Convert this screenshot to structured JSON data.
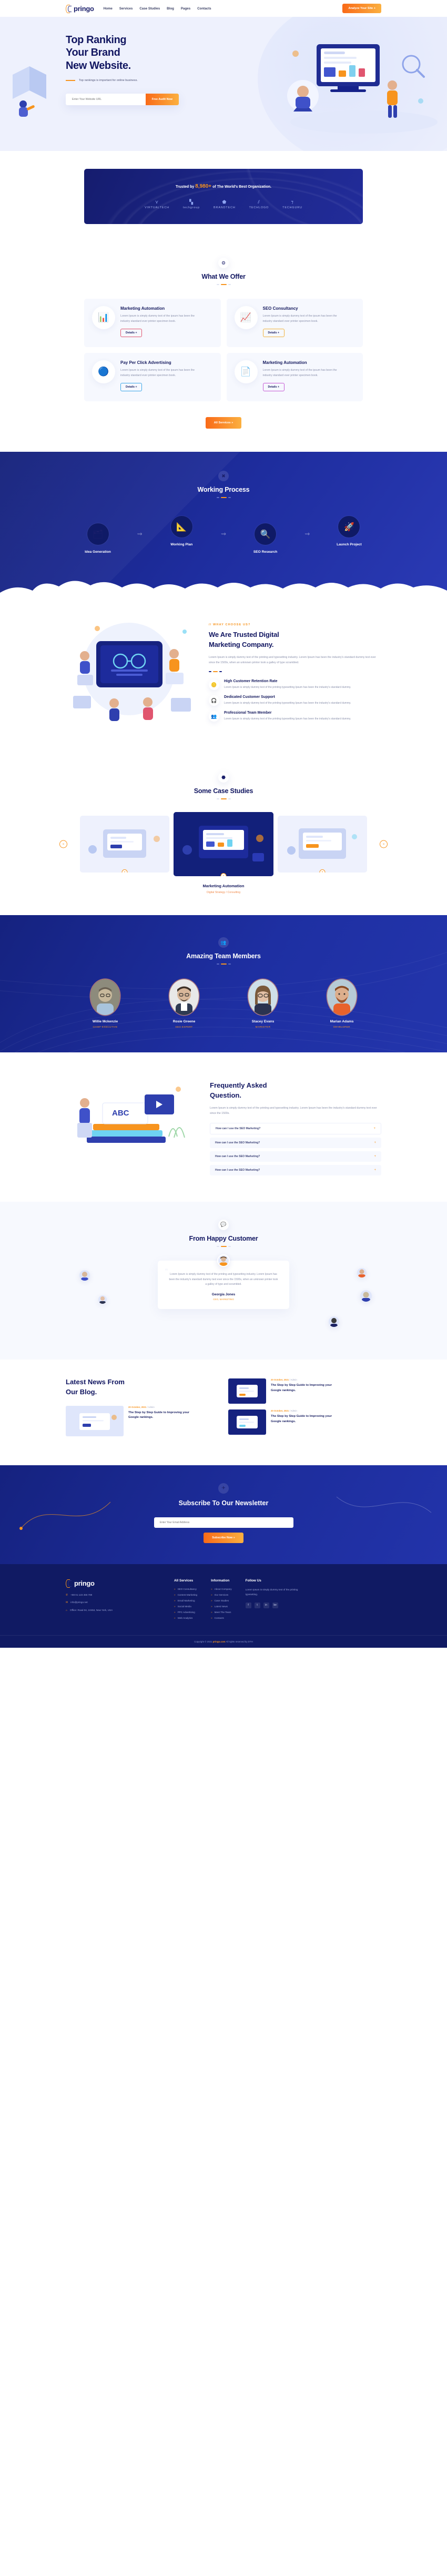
{
  "brand": {
    "name": "pringo",
    "logo_icon": "pringo-chevron-logo"
  },
  "header": {
    "nav": [
      {
        "label": "Home"
      },
      {
        "label": "Services"
      },
      {
        "label": "Case Studies"
      },
      {
        "label": "Blog"
      },
      {
        "label": "Pages"
      },
      {
        "label": "Contacts"
      }
    ],
    "cta": "Analyze Your Site  +"
  },
  "hero": {
    "title_l1": "Top Ranking",
    "title_l2": "Your Brand",
    "title_l3": "New Website.",
    "subtitle": "Top rankings is important for online business.",
    "input_placeholder": "Enter Your Website URL",
    "input_value": "",
    "button": "Free Audit Now"
  },
  "trusted": {
    "prefix": "Trusted by",
    "count": "8,980+",
    "suffix": "of The World's Best Organization.",
    "brands": [
      {
        "name": "VIRTUALTECH",
        "icon": "v-mark-icon"
      },
      {
        "name": "techgroup",
        "icon": "squares-icon"
      },
      {
        "name": "BRANDTECH",
        "icon": "shield-icon"
      },
      {
        "name": "TECHLOGO",
        "icon": "slashes-icon"
      },
      {
        "name": "TECHGURU",
        "icon": "seven-icon"
      }
    ]
  },
  "offer": {
    "icon": "gear-burst-icon",
    "title": "What We Offer",
    "cards": [
      {
        "icon": "bar-chart-icon",
        "accent": "#e0556f",
        "title": "Marketing Automation",
        "text": "Lorem Ipsum is simply dummy text of the ipsum has been the industry standard ever printer specimen book.",
        "button": "Details +"
      },
      {
        "icon": "line-chart-icon",
        "accent": "#f2b23c",
        "title": "SEO Consultancy",
        "text": "Lorem Ipsum is simply dummy text of the ipsum has been the industry standard ever printer specimen book.",
        "button": "Details +"
      },
      {
        "icon": "dots-icon",
        "accent": "#3ba7e8",
        "title": "Pay Per Click Advertising",
        "text": "Lorem Ipsum is simply dummy text of the ipsum has been the industry standard ever printer specimen book.",
        "button": "Details +"
      },
      {
        "icon": "document-icon",
        "accent": "#c65bd6",
        "title": "Marketing Automation",
        "text": "Lorem Ipsum is simply dummy text of the ipsum has been the industry standard ever printer specimen book.",
        "button": "Details +"
      }
    ],
    "all_button": "All Services  »"
  },
  "process": {
    "icon": "cross-tools-icon",
    "title": "Working Process",
    "steps": [
      {
        "icon": "layers-icon",
        "label": "Idea Generation"
      },
      {
        "icon": "design-pencil-icon",
        "label": "Working Plan"
      },
      {
        "icon": "magnifier-icon",
        "label": "SEO Research"
      },
      {
        "icon": "rocket-icon",
        "label": "Launch Project"
      }
    ]
  },
  "why": {
    "eyebrow": "// WHAY CHOOSE US?",
    "title_l1": "We Are Trusted Digital",
    "title_l2": "Marketing Company.",
    "text": "Lorem Ipsum is simply dummy text of the printing and typesetting industry. Lorem Ipsum has been the industry's standard dummy text ever since the 1500s, when an unknown printer took a galley of type scrambled.",
    "features": [
      {
        "icon": "coin-icon",
        "title": "High Customer Retention Rate",
        "text": "Lorem Ipsum is simply dummy text of the printing typesetting Ipsum has been the industry's standard dummy."
      },
      {
        "icon": "headset-icon",
        "title": "Dedicated Customer Support",
        "text": "Lorem Ipsum is simply dummy text of the printing typesetting Ipsum has been the industry's standard dummy."
      },
      {
        "icon": "team-icon",
        "title": "Professional Team Member",
        "text": "Lorem Ipsum is simply dummy text of the printing typesetting Ipsum has been the industry's standard dummy."
      }
    ]
  },
  "cases": {
    "icon": "hexagon-icon",
    "title": "Some Case Studies",
    "active_title": "Marketing Automation",
    "active_sub": "Digital Strategy / Consulting",
    "prev": "«",
    "next": "»",
    "plus": "+"
  },
  "team": {
    "icon": "people-icon",
    "title": "Amazing Team Members",
    "members": [
      {
        "name": "Willie Mckenzie",
        "role": "CHIEF EXECUTIVE",
        "skin": "#c8b99c",
        "shirt": "#a8c4dd",
        "bg": "#8d8b7c"
      },
      {
        "name": "Rosie Greene",
        "role": "SEO EXPERT",
        "skin": "#d8b79a",
        "shirt": "#2e3a52",
        "bg": "#e8e8e8"
      },
      {
        "name": "Stacey Evans",
        "role": "MARKETER",
        "skin": "#e3c0a6",
        "shirt": "#2b3350",
        "bg": "#cfe0e8"
      },
      {
        "name": "Marian Adams",
        "role": "DEVELOPER",
        "skin": "#dcae8c",
        "shirt": "#e8622c",
        "bg": "#b7cbd6"
      }
    ]
  },
  "faq": {
    "title_l1": "Frequently Asked",
    "title_l2": "Question.",
    "text": "Lorem Ipsum is simply dummy text of the printing and typesetting industry. Lorem Ipsum has been the industry's standard dummy text ever since the 1500s.",
    "items": [
      {
        "q": "How can I use the SEO Marketing?",
        "state": "open"
      },
      {
        "q": "How can I use the SEO Marketing?",
        "state": "closed"
      },
      {
        "q": "How can I use the SEO Marketing?",
        "state": "closed"
      },
      {
        "q": "How can I use the SEO Marketing?",
        "state": "closed"
      }
    ],
    "toggle_icon": "plus-icon"
  },
  "testimonial": {
    "icon": "quote-badge-icon",
    "title": "From Happy Customer",
    "quote": "Lorem Ipsum is simply dummy text of the printing and typesetting industry. Lorem Ipsum has been the industry's standard dummy text ever since the 1500s, when an unknown printer took a galley of type and scrambled.",
    "author": "Georgia Jones",
    "role": "CEO, MARKETING",
    "quote_mark": "“"
  },
  "blog": {
    "title_l1": "Latest News From",
    "title_l2": "Our Blog.",
    "posts": [
      {
        "date": "20 October, 2021",
        "author": "Admin",
        "title": "The Step by Step Guide to Improving your Google rankings."
      },
      {
        "date": "20 October, 2021",
        "author": "Admin",
        "title": "The Step by Step Guide to Improving your Google rankings."
      },
      {
        "date": "20 October, 2021",
        "author": "Admin",
        "title": "The Step by Step Guide to Improving your Google rankings."
      }
    ]
  },
  "newsletter": {
    "icon": "paper-plane-icon",
    "title": "Subscribe To Our Newsletter",
    "placeholder": "Enter Your Email Address",
    "value": "",
    "button": "Subscribe Now  »"
  },
  "footer": {
    "about": [
      {
        "icon": "phone-icon",
        "text": "+88 01 123 456 789"
      },
      {
        "icon": "mail-icon",
        "text": "info@pringo.net"
      },
      {
        "icon": "pin-icon",
        "text": "Office: Road 04, 10453, New York, USA"
      }
    ],
    "columns": [
      {
        "heading": "All Services",
        "links": [
          "SEO Consultancy",
          "Content Marketing",
          "Email Marketing",
          "Social Media",
          "PPC Advertising",
          "Web Analytics"
        ]
      },
      {
        "heading": "Information",
        "links": [
          "About Company",
          "Our Services",
          "Case Studies",
          "Latest News",
          "Meet The Team",
          "Contacts"
        ]
      }
    ],
    "follow": {
      "heading": "Follow Us",
      "text": "Lorem Ipsum is simply dummy text of the printing typesetting.",
      "socials": [
        "f",
        "t",
        "in",
        "be"
      ]
    },
    "copyright_prefix": "Copyright © 2021 ",
    "copyright_brand": "pringo.com",
    "copyright_suffix": " All rights reserved by DTH"
  }
}
